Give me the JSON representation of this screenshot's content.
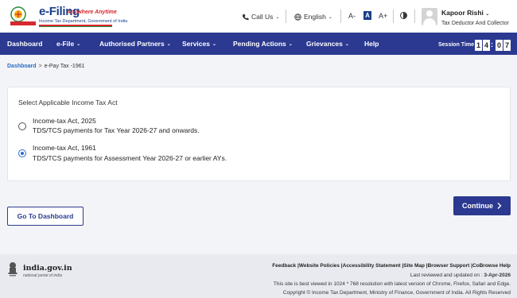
{
  "header": {
    "logo_title": "e-Filing",
    "logo_tagline": "Anywhere Anytime",
    "logo_subtitle": "Income Tax Department, Government of India",
    "call_us": "Call Us",
    "language": "English",
    "font_decrease": "A-",
    "font_normal": "A",
    "font_increase": "A+",
    "user_name": "Kapoor Rishi",
    "user_role": "Tax Deductor And Collector"
  },
  "nav": {
    "items": [
      {
        "label": "Dashboard",
        "has_chevron": false
      },
      {
        "label": "e-File",
        "has_chevron": true
      },
      {
        "label": "Authorised Partners",
        "has_chevron": true
      },
      {
        "label": "Services",
        "has_chevron": true
      },
      {
        "label": "Pending Actions",
        "has_chevron": true
      },
      {
        "label": "Grievances",
        "has_chevron": true
      },
      {
        "label": "Help",
        "has_chevron": false
      }
    ],
    "session_label": "Session Time",
    "session_digits": [
      "1",
      "4",
      "0",
      "7"
    ]
  },
  "breadcrumb": {
    "parent": "Dashboard",
    "separator": ">",
    "current": "e-Pay Tax -1961"
  },
  "form": {
    "title": "Select Applicable Income Tax Act",
    "options": [
      {
        "title": "Income-tax Act, 2025",
        "subtitle": "TDS/TCS payments for Tax Year 2026-27 and onwards.",
        "selected": false
      },
      {
        "title": "Income-tax Act, 1961",
        "subtitle": "TDS/TCS payments for Assessment Year 2026-27 or earlier AYs.",
        "selected": true
      }
    ]
  },
  "buttons": {
    "continue": "Continue",
    "dashboard": "Go To Dashboard"
  },
  "footer": {
    "portal_name": "india.gov.in",
    "portal_sub": "national portal of india",
    "links": [
      "Feedback",
      "Website Policies",
      "Accessibility Statement",
      "Site Map",
      "Browser Support",
      "CoBrowse Help"
    ],
    "updated_prefix": "Last reviewed and updated on : ",
    "updated_date": "3-Apr-2026",
    "best_viewed": "This site is best viewed in 1024 * 768 resolution with latest version of Chrome, Firefox, Safari and Edge.",
    "copyright": "Copyright © Income Tax Department, Ministry of Finance, Government of India. All Rights Reserved"
  },
  "colors": {
    "primary": "#2b3990",
    "link": "#2b6cc4",
    "brand_red": "#d7282f"
  }
}
